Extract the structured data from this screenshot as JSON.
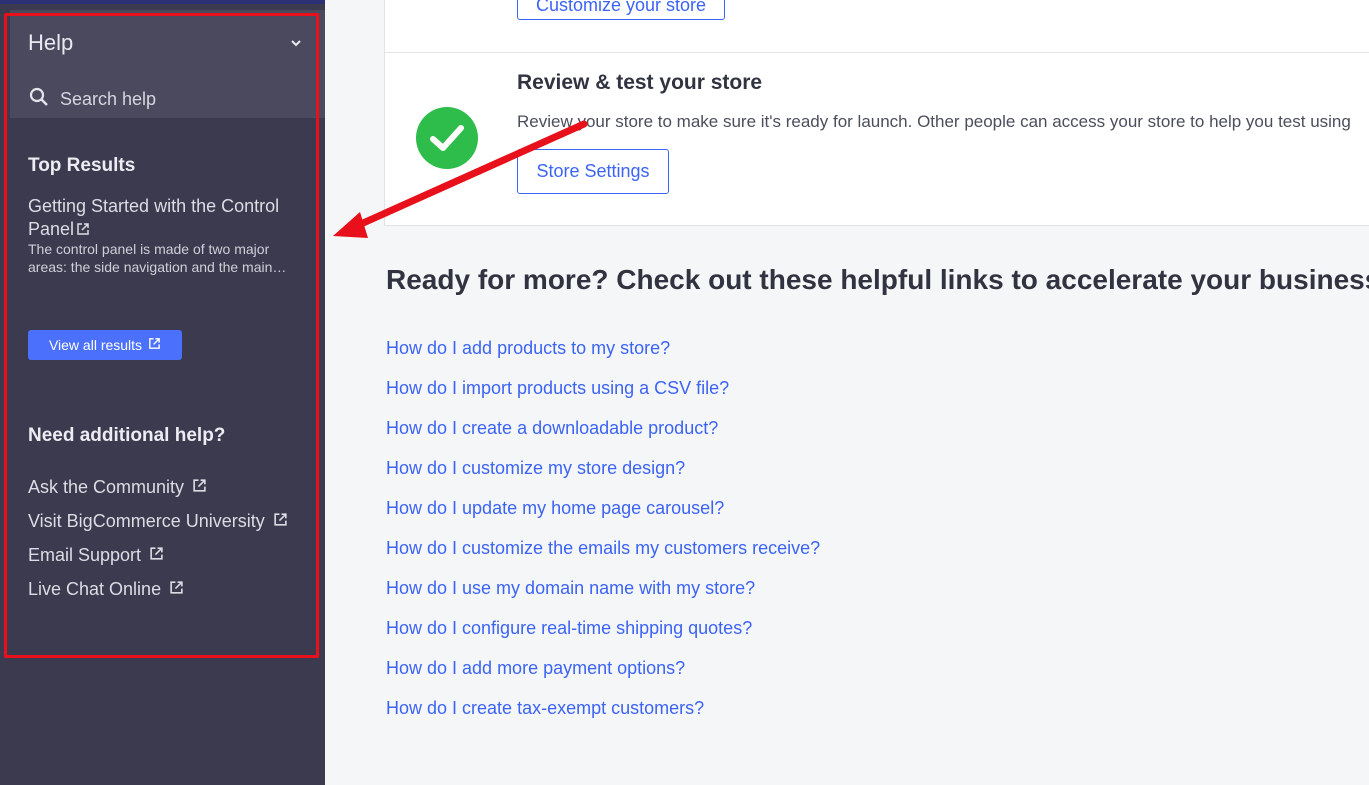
{
  "sidebar": {
    "title": "Help",
    "search_label": "Search help",
    "top_results_heading": "Top Results",
    "result": {
      "title": "Getting Started with the Control Panel",
      "description": "The control panel is made of two major areas: the side navigation and the main content area."
    },
    "view_all_label": "View all results",
    "need_help_heading": "Need additional help?",
    "help_links": [
      {
        "label": "Ask the Community"
      },
      {
        "label": "Visit BigCommerce University"
      },
      {
        "label": "Email Support"
      },
      {
        "label": "Live Chat Online"
      }
    ]
  },
  "main": {
    "customize_button": "Customize your store",
    "review": {
      "title": "Review & test your store",
      "description": "Review your store to make sure it's ready for launch. Other people can access your store to help you test using",
      "button": "Store Settings"
    },
    "ready_heading": "Ready for more? Check out these helpful links to accelerate your business.",
    "faq_links": [
      "How do I add products to my store?",
      "How do I import products using a CSV file?",
      "How do I create a downloadable product?",
      "How do I customize my store design?",
      "How do I update my home page carousel?",
      "How do I customize the emails my customers receive?",
      "How do I use my domain name with my store?",
      "How do I configure real-time shipping quotes?",
      "How do I add more payment options?",
      "How do I create tax-exempt customers?"
    ]
  },
  "colors": {
    "sidebar_bg": "#3b3a4f",
    "accent": "#3c64f4",
    "check": "#2ebd4a",
    "annotation": "#e8101a"
  }
}
